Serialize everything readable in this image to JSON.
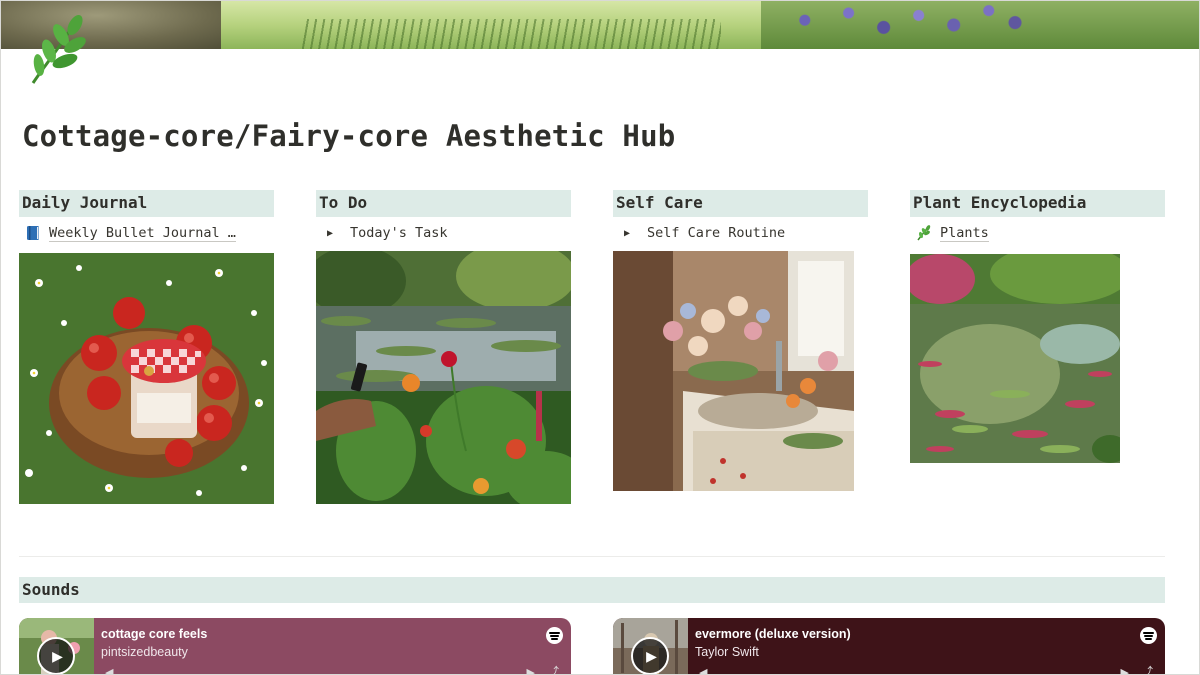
{
  "page": {
    "title": "Cottage-core/Fairy-core Aesthetic Hub"
  },
  "colors": {
    "header_bg": "#ddebe7",
    "embed_1_bg": "#8c4a62",
    "embed_2_bg": "#3e1318"
  },
  "icons": {
    "page_icon": "herb-icon",
    "journal_link": "blue-book-icon",
    "plants_link": "herb-icon",
    "toggle": "triangle-right-icon"
  },
  "columns": [
    {
      "header": "Daily Journal",
      "link": "Weekly Bullet Journal …"
    },
    {
      "header": "To Do",
      "link": "Today's Task"
    },
    {
      "header": "Self Care",
      "link": "Self Care Routine"
    },
    {
      "header": "Plant Encyclopedia",
      "link": "Plants"
    }
  ],
  "sounds": {
    "header": "Sounds",
    "embeds": [
      {
        "title": "cottage core feels",
        "artist": "pintsizedbeauty"
      },
      {
        "title": "evermore (deluxe version)",
        "artist": "Taylor Swift"
      }
    ]
  }
}
